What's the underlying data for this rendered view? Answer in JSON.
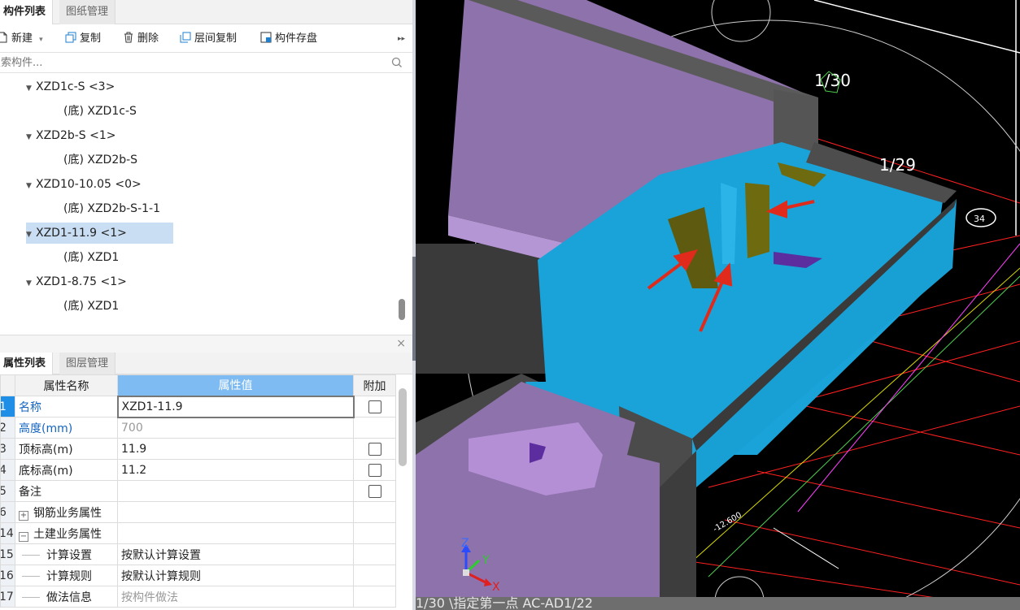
{
  "top_tabs": {
    "components": "构件列表",
    "drawings": "图纸管理"
  },
  "toolbar": {
    "new_label": "新建",
    "copy_label": "复制",
    "delete_label": "删除",
    "floor_copy_label": "层间复制",
    "save_label": "构件存盘",
    "more_label": "▸▸"
  },
  "search": {
    "placeholder": "搜索构件..."
  },
  "tree": [
    {
      "label": "XZD1c-S <3>",
      "child": "(底) XZD1c-S"
    },
    {
      "label": "XZD2b-S <1>",
      "child": "(底) XZD2b-S"
    },
    {
      "label": "XZD10-10.05 <0>",
      "child": "(底) XZD2b-S-1-1"
    },
    {
      "label": "XZD1-11.9 <1>",
      "child": "(底) XZD1",
      "selected": true
    },
    {
      "label": "XZD1-8.75 <1>",
      "child": "(底) XZD1"
    }
  ],
  "bottom_tabs": {
    "properties": "属性列表",
    "layers": "图层管理"
  },
  "close_glyph": "×",
  "prop_table": {
    "headers": [
      "属性名称",
      "属性值",
      "附加"
    ],
    "rows": [
      {
        "num": "1",
        "name": "名称",
        "value": "XZD1-11.9",
        "checkbox": true
      },
      {
        "num": "2",
        "name": "高度(mm)",
        "value": "700",
        "checkbox": false
      },
      {
        "num": "3",
        "name": "顶标高(m)",
        "value": "11.9",
        "checkbox": true
      },
      {
        "num": "4",
        "name": "底标高(m)",
        "value": "11.2",
        "checkbox": true
      },
      {
        "num": "5",
        "name": "备注",
        "value": "",
        "checkbox": true
      },
      {
        "num": "6",
        "name": "钢筋业务属性",
        "expander": "+",
        "value": "",
        "checkbox": false
      },
      {
        "num": "14",
        "name": "土建业务属性",
        "expander": "−",
        "value": "",
        "checkbox": false
      },
      {
        "num": "15",
        "name": "计算设置",
        "value": "按默认计算设置",
        "child": true,
        "checkbox": false
      },
      {
        "num": "16",
        "name": "计算规则",
        "value": "按默认计算规则",
        "child": true,
        "checkbox": false
      },
      {
        "num": "17",
        "name": "做法信息",
        "value": "按构件做法",
        "child": true,
        "checkbox": false
      }
    ]
  },
  "viewport": {
    "labels": {
      "scale_30": "1/30",
      "scale_29": "1/29",
      "bubble": "34",
      "elev": "-12.600",
      "axis_z": "Z",
      "axis_y": "Y",
      "axis_x": "X"
    },
    "status": "1/30                    \\指定第一点                    AC-AD1/22",
    "colors": {
      "slab_purple": "#8e72ab",
      "wall_purple": "#a77fc7",
      "water_blue": "#1aa3d9",
      "beam_gray": "#4a4a4a",
      "dark_olive": "#5e5a0f",
      "arrow_red": "#e02a1b",
      "grid_red": "#ff2020"
    }
  }
}
